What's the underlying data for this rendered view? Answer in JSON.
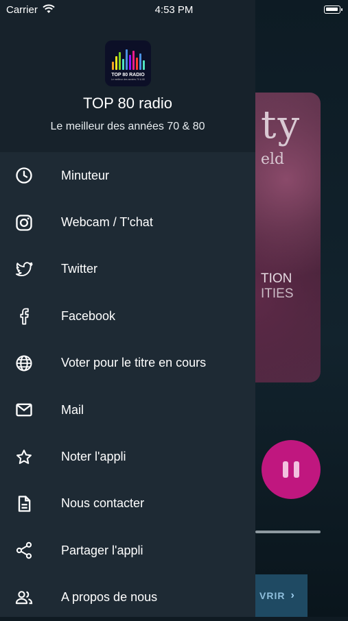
{
  "status_bar": {
    "carrier": "Carrier",
    "time": "4:53 PM"
  },
  "drawer": {
    "logo": {
      "name": "TOP 80 RADIO",
      "tagline": "Le meilleur des années 70 & 80"
    },
    "title": "TOP 80 radio",
    "subtitle": "Le meilleur des années 70 & 80",
    "items": [
      {
        "label": "Minuteur",
        "icon": "clock-icon"
      },
      {
        "label": "Webcam / T'chat",
        "icon": "instagram-icon"
      },
      {
        "label": "Twitter",
        "icon": "twitter-icon"
      },
      {
        "label": "Facebook",
        "icon": "facebook-icon"
      },
      {
        "label": "Voter pour le titre en cours",
        "icon": "globe-icon"
      },
      {
        "label": "Mail",
        "icon": "mail-icon"
      },
      {
        "label": "Noter l'appli",
        "icon": "star-icon"
      },
      {
        "label": "Nous contacter",
        "icon": "document-icon"
      },
      {
        "label": "Partager l'appli",
        "icon": "share-icon"
      },
      {
        "label": "A propos de nous",
        "icon": "people-icon"
      }
    ]
  },
  "background_app": {
    "album_text": [
      "ty",
      "eld",
      "TION",
      "ITIES"
    ],
    "open_button": "VRIR",
    "accent_color": "#c0177f"
  }
}
